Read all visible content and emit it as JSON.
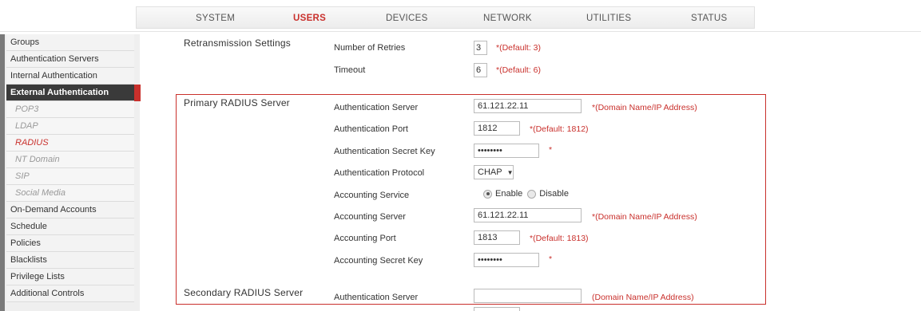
{
  "nav": {
    "items": [
      "SYSTEM",
      "USERS",
      "DEVICES",
      "NETWORK",
      "UTILITIES",
      "STATUS"
    ],
    "active": "USERS"
  },
  "sidebar": {
    "items": [
      {
        "label": "Groups"
      },
      {
        "label": "Authentication Servers"
      },
      {
        "label": "Internal Authentication"
      },
      {
        "label": "External Authentication"
      },
      {
        "label": "POP3"
      },
      {
        "label": "LDAP"
      },
      {
        "label": "RADIUS"
      },
      {
        "label": "NT Domain"
      },
      {
        "label": "SIP"
      },
      {
        "label": "Social Media"
      },
      {
        "label": "On-Demand Accounts"
      },
      {
        "label": "Schedule"
      },
      {
        "label": "Policies"
      },
      {
        "label": "Blacklists"
      },
      {
        "label": "Privilege Lists"
      },
      {
        "label": "Additional Controls"
      }
    ]
  },
  "retransmission": {
    "title": "Retransmission Settings",
    "retries_label": "Number of Retries",
    "retries_value": "3",
    "retries_hint": "*(Default: 3)",
    "timeout_label": "Timeout",
    "timeout_value": "6",
    "timeout_hint": "*(Default: 6)"
  },
  "primary": {
    "title": "Primary RADIUS Server",
    "auth_server_label": "Authentication Server",
    "auth_server_value": "61.121.22.11",
    "auth_server_hint": "*(Domain Name/IP Address)",
    "auth_port_label": "Authentication Port",
    "auth_port_value": "1812",
    "auth_port_hint": "*(Default: 1812)",
    "secret_label": "Authentication Secret Key",
    "secret_value": "••••••••",
    "secret_hint": "*",
    "protocol_label": "Authentication Protocol",
    "protocol_value": "CHAP",
    "acct_service_label": "Accounting Service",
    "acct_enable": "Enable",
    "acct_disable": "Disable",
    "acct_server_label": "Accounting Server",
    "acct_server_value": "61.121.22.11",
    "acct_server_hint": "*(Domain Name/IP Address)",
    "acct_port_label": "Accounting Port",
    "acct_port_value": "1813",
    "acct_port_hint": "*(Default: 1813)",
    "acct_secret_label": "Accounting Secret Key",
    "acct_secret_value": "••••••••",
    "acct_secret_hint": "*"
  },
  "secondary": {
    "title": "Secondary RADIUS Server",
    "auth_server_label": "Authentication Server",
    "auth_server_value": "",
    "auth_server_hint": "(Domain Name/IP Address)"
  },
  "colors": {
    "accent": "#c9302c",
    "sidebar_active": "#3a3a3a"
  }
}
